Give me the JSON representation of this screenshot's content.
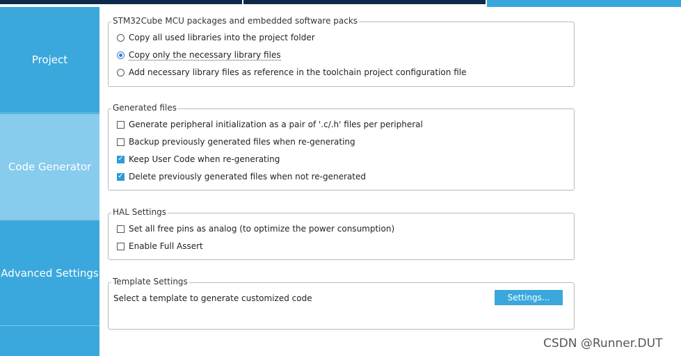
{
  "sidebar": {
    "items": [
      {
        "label": "Project",
        "active": false
      },
      {
        "label": "Code Generator",
        "active": true
      },
      {
        "label": "Advanced Settings",
        "active": false
      }
    ]
  },
  "packages": {
    "legend": "STM32Cube MCU packages and embedded software packs",
    "options": [
      {
        "label": "Copy all used libraries into the project folder",
        "selected": false
      },
      {
        "label": "Copy only the necessary library files",
        "selected": true
      },
      {
        "label": "Add necessary library files as reference in the toolchain project configuration file",
        "selected": false
      }
    ]
  },
  "generated": {
    "legend": "Generated files",
    "options": [
      {
        "label": "Generate peripheral initialization as a pair of '.c/.h' files per peripheral",
        "checked": false
      },
      {
        "label": "Backup previously generated files when re-generating",
        "checked": false
      },
      {
        "label": "Keep User Code when re-generating",
        "checked": true
      },
      {
        "label": "Delete previously generated files when not re-generated",
        "checked": true
      }
    ]
  },
  "hal": {
    "legend": "HAL Settings",
    "options": [
      {
        "label": "Set all free pins as analog (to optimize the power consumption)",
        "checked": false
      },
      {
        "label": "Enable Full Assert",
        "checked": false
      }
    ]
  },
  "template": {
    "legend": "Template Settings",
    "description": "Select a template to generate customized code",
    "button_label": "Settings..."
  },
  "watermark": "CSDN @Runner.DUT",
  "colors": {
    "accent": "#3aa8dc",
    "active_sidebar": "#87cbed",
    "dark_tab": "#0d2a4a"
  }
}
